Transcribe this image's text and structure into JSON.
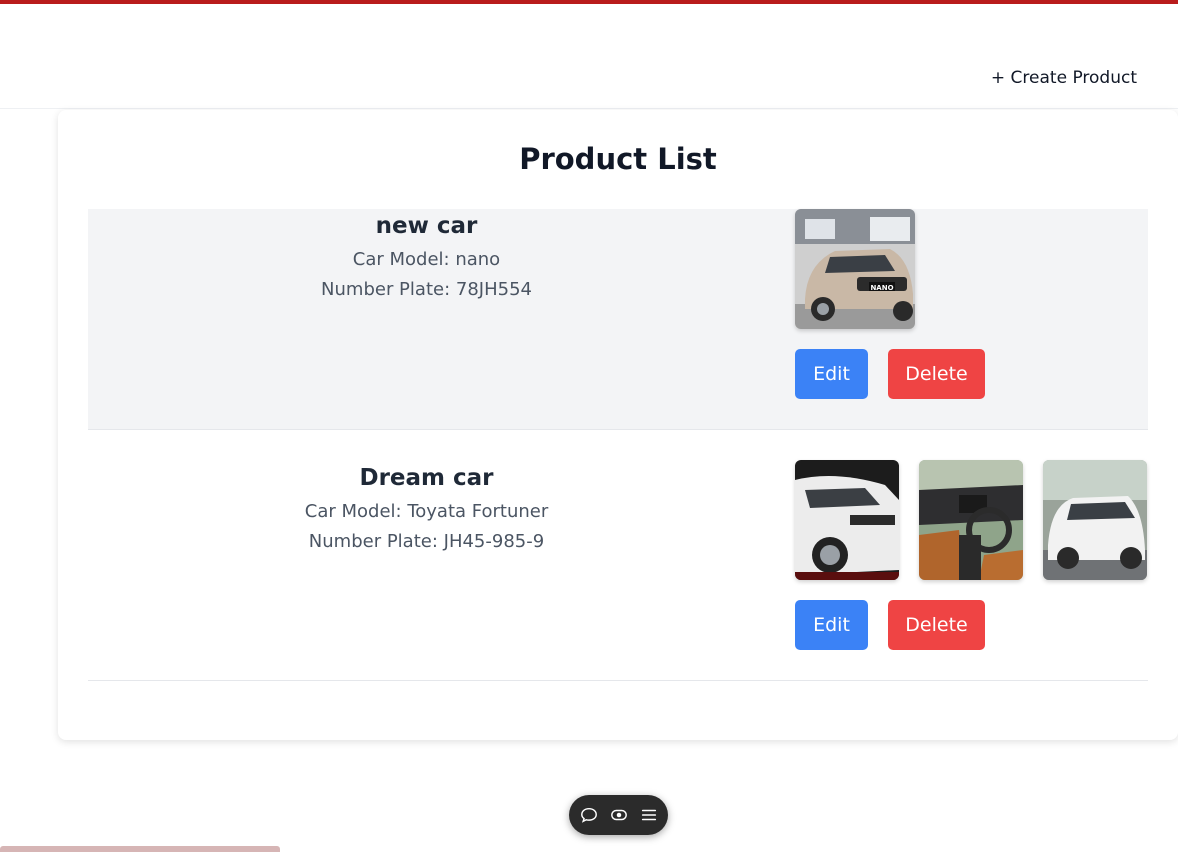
{
  "header": {
    "create_label": "+ Create Product"
  },
  "page": {
    "title": "Product List"
  },
  "products": [
    {
      "name": "new car",
      "model": "Car Model: nano",
      "plate": "Number Plate: 78JH554",
      "images": [
        "car-nano-front-image"
      ],
      "plate_badge": "NANO",
      "edit_label": "Edit",
      "delete_label": "Delete"
    },
    {
      "name": "Dream car",
      "model": "Car Model: Toyata Fortuner",
      "plate": "Number Plate: JH45-985-9",
      "images": [
        "car-fortuner-front-image",
        "car-fortuner-interior-image",
        "car-fortuner-rear-image"
      ],
      "edit_label": "Edit",
      "delete_label": "Delete"
    }
  ],
  "toolbar": {
    "icons": [
      "comment-icon",
      "eye-icon",
      "menu-icon"
    ]
  },
  "colors": {
    "accent": "#b91c1c",
    "edit": "#3b82f6",
    "delete": "#ef4444",
    "row_highlight": "#f3f4f6"
  }
}
